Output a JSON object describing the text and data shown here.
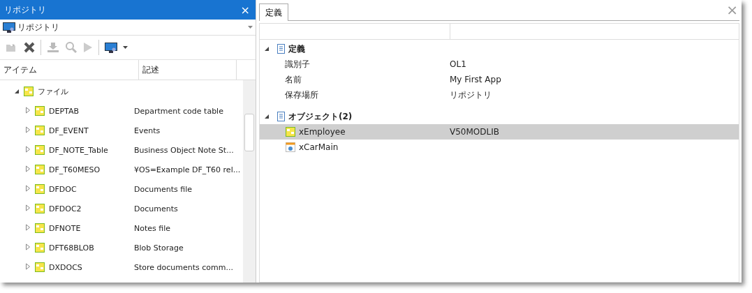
{
  "left_panel": {
    "title": "リポジトリ",
    "close": "×",
    "repository_select": {
      "value": "リポジトリ"
    },
    "columns": [
      "アイテム",
      "記述"
    ],
    "tree": [
      {
        "label": "ファイル",
        "expanded": true,
        "children": [
          {
            "label": "DEPTAB",
            "description": "Department code table",
            "expanded": false
          },
          {
            "label": "DF_EVENT",
            "description": "Events",
            "expanded": false
          },
          {
            "label": "DF_NOTE_Table",
            "description": "Business Object Note St...",
            "expanded": false
          },
          {
            "label": "DF_T60MESO",
            "description": "¥OS=Example DF_T60 rel...",
            "expanded": false
          },
          {
            "label": "DFDOC",
            "description": "Documents file",
            "expanded": false
          },
          {
            "label": "DFDOC2",
            "description": "Documents",
            "expanded": false
          },
          {
            "label": "DFNOTE",
            "description": "Notes file",
            "expanded": false
          },
          {
            "label": "DFT68BLOB",
            "description": "Blob Storage",
            "expanded": false
          },
          {
            "label": "DXDOCS",
            "description": "Store documents comm...",
            "expanded": false
          }
        ]
      }
    ]
  },
  "right_panel": {
    "tabs": [
      {
        "label": "定義",
        "selected": true
      }
    ],
    "close": "×",
    "groups": [
      {
        "title": "定義",
        "expanded": true,
        "rows": [
          {
            "name": "識別子",
            "value": "OL1",
            "selected": false
          },
          {
            "name": "名前",
            "value": "My First App",
            "selected": false
          },
          {
            "name": "保存場所",
            "value": "リポジトリ",
            "selected": false
          }
        ]
      },
      {
        "title": "オブジェクト(2)",
        "expanded": true,
        "rows": [
          {
            "kind": "file",
            "name": "xEmployee",
            "value": "V50MODLIB",
            "selected": true
          },
          {
            "kind": "form",
            "name": "xCarMain",
            "selected": false
          }
        ]
      }
    ]
  }
}
